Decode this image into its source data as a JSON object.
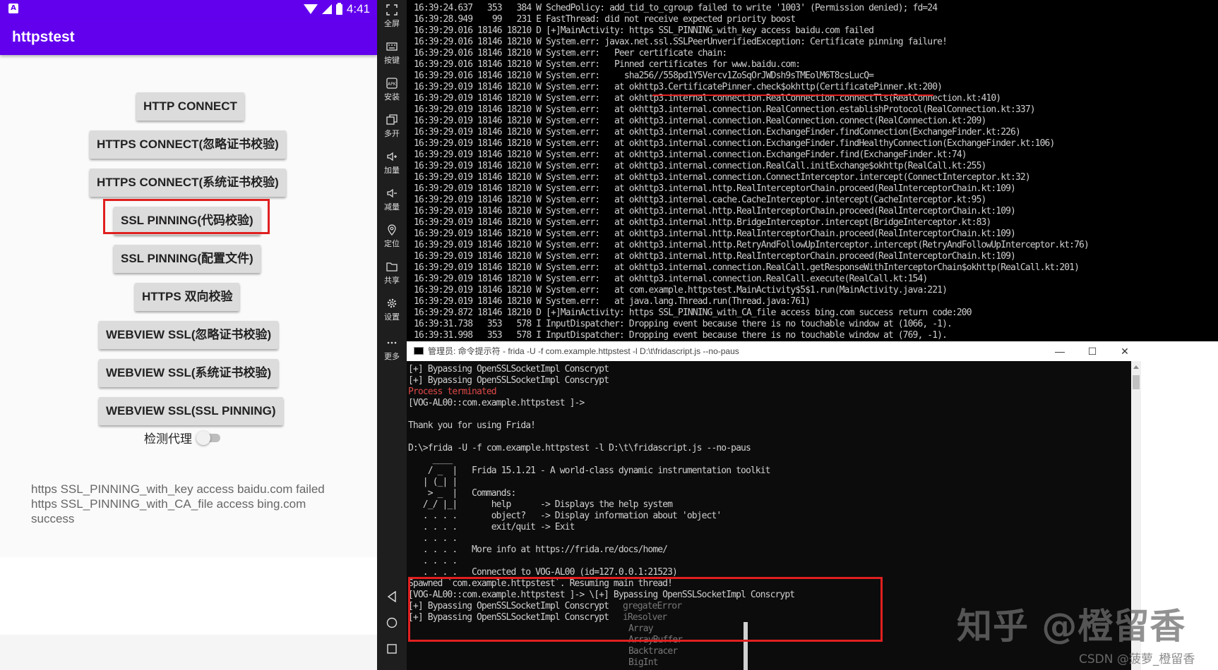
{
  "phone": {
    "status_bar": {
      "time": "4:41",
      "notification_icon": "A"
    },
    "app_title": "httpstest",
    "buttons": [
      {
        "label": "HTTP CONNECT"
      },
      {
        "label": "HTTPS CONNECT(忽略证书校验)"
      },
      {
        "label": "HTTPS CONNECT(系统证书校验)"
      },
      {
        "label": "SSL PINNING(代码校验)"
      },
      {
        "label": "SSL PINNING(配置文件)"
      },
      {
        "label": "HTTPS 双向校验"
      },
      {
        "label": "WEBVIEW SSL(忽略证书校验)"
      },
      {
        "label": "WEBVIEW SSL(系统证书校验)"
      },
      {
        "label": "WEBVIEW SSL(SSL PINNING)"
      }
    ],
    "proxy_toggle": {
      "label": "检测代理",
      "on": false
    },
    "result_lines": [
      "https SSL_PINNING_with_key access baidu.com failed",
      "https SSL_PINNING_with_CA_file access bing.com",
      "success"
    ]
  },
  "toolbar": {
    "items": [
      {
        "label": "全屏",
        "icon": "fullscreen-icon"
      },
      {
        "label": "按键",
        "icon": "keyboard-icon"
      },
      {
        "label": "安装",
        "icon": "apk-icon"
      },
      {
        "label": "多开",
        "icon": "multi-instance-icon"
      },
      {
        "label": "加量",
        "icon": "volume-up-icon"
      },
      {
        "label": "减量",
        "icon": "volume-down-icon"
      },
      {
        "label": "定位",
        "icon": "location-icon"
      },
      {
        "label": "共享",
        "icon": "folder-icon"
      },
      {
        "label": "设置",
        "icon": "gear-icon"
      },
      {
        "label": "更多",
        "icon": "more-icon"
      }
    ],
    "nav": [
      "back-icon",
      "home-icon",
      "recents-icon"
    ]
  },
  "logcat": {
    "lines": [
      "16:39:24.637   353   384 W SchedPolicy: add_tid_to_cgroup failed to write '1003' (Permission denied); fd=24",
      "16:39:28.949    99   231 E FastThread: did not receive expected priority boost",
      "16:39:29.016 18146 18210 D [+]MainActivity: https SSL_PINNING_with_key access baidu.com failed",
      "16:39:29.016 18146 18210 W System.err: javax.net.ssl.SSLPeerUnverifiedException: Certificate pinning failure!",
      "16:39:29.016 18146 18210 W System.err:   Peer certificate chain:",
      "16:39:29.016 18146 18210 W System.err:   Pinned certificates for www.baidu.com:",
      "16:39:29.016 18146 18210 W System.err:     sha256//558pd1Y5Vercv1ZoSqOrJWDsh9sTMEolM6T8csLucQ=",
      "16:39:29.019 18146 18210 W System.err:   at okhttp3.CertificatePinner.check$okhttp(CertificatePinner.kt:200)",
      "16:39:29.019 18146 18210 W System.err:   at okhttp3.internal.connection.RealConnection.connectTls(RealConnection.kt:410)",
      "16:39:29.019 18146 18210 W System.err:   at okhttp3.internal.connection.RealConnection.establishProtocol(RealConnection.kt:337)",
      "16:39:29.019 18146 18210 W System.err:   at okhttp3.internal.connection.RealConnection.connect(RealConnection.kt:209)",
      "16:39:29.019 18146 18210 W System.err:   at okhttp3.internal.connection.ExchangeFinder.findConnection(ExchangeFinder.kt:226)",
      "16:39:29.019 18146 18210 W System.err:   at okhttp3.internal.connection.ExchangeFinder.findHealthyConnection(ExchangeFinder.kt:106)",
      "16:39:29.019 18146 18210 W System.err:   at okhttp3.internal.connection.ExchangeFinder.find(ExchangeFinder.kt:74)",
      "16:39:29.019 18146 18210 W System.err:   at okhttp3.internal.connection.RealCall.initExchange$okhttp(RealCall.kt:255)",
      "16:39:29.019 18146 18210 W System.err:   at okhttp3.internal.connection.ConnectInterceptor.intercept(ConnectInterceptor.kt:32)",
      "16:39:29.019 18146 18210 W System.err:   at okhttp3.internal.http.RealInterceptorChain.proceed(RealInterceptorChain.kt:109)",
      "16:39:29.019 18146 18210 W System.err:   at okhttp3.internal.cache.CacheInterceptor.intercept(CacheInterceptor.kt:95)",
      "16:39:29.019 18146 18210 W System.err:   at okhttp3.internal.http.RealInterceptorChain.proceed(RealInterceptorChain.kt:109)",
      "16:39:29.019 18146 18210 W System.err:   at okhttp3.internal.http.BridgeInterceptor.intercept(BridgeInterceptor.kt:83)",
      "16:39:29.019 18146 18210 W System.err:   at okhttp3.internal.http.RealInterceptorChain.proceed(RealInterceptorChain.kt:109)",
      "16:39:29.019 18146 18210 W System.err:   at okhttp3.internal.http.RetryAndFollowUpInterceptor.intercept(RetryAndFollowUpInterceptor.kt:76)",
      "16:39:29.019 18146 18210 W System.err:   at okhttp3.internal.http.RealInterceptorChain.proceed(RealInterceptorChain.kt:109)",
      "16:39:29.019 18146 18210 W System.err:   at okhttp3.internal.connection.RealCall.getResponseWithInterceptorChain$okhttp(RealCall.kt:201)",
      "16:39:29.019 18146 18210 W System.err:   at okhttp3.internal.connection.RealCall.execute(RealCall.kt:154)",
      "16:39:29.019 18146 18210 W System.err:   at com.example.httpstest.MainActivity$5$1.run(MainActivity.java:221)",
      "16:39:29.019 18146 18210 W System.err:   at java.lang.Thread.run(Thread.java:761)",
      "16:39:29.872 18146 18210 D [+]MainActivity: https SSL_PINNING_with_CA_file access bing.com success return code:200",
      "16:39:31.738   353   578 I InputDispatcher: Dropping event because there is no touchable window at (1066, -1).",
      "16:39:31.998   353   578 I InputDispatcher: Dropping event because there is no touchable window at (769, -1)."
    ]
  },
  "cmd": {
    "title": "管理员: 命令提示符 - frida  -U -f com.example.httpstest -l D:\\t\\fridascript.js --no-paus",
    "window_controls": [
      "—",
      "☐",
      "✕"
    ],
    "lines": [
      {
        "text": "[+] Bypassing OpenSSLSocketImpl Conscrypt",
        "red": false
      },
      {
        "text": "[+] Bypassing OpenSSLSocketImpl Conscrypt",
        "red": false
      },
      {
        "text": "Process terminated",
        "red": true
      },
      {
        "text": "[VOG-AL00::com.example.httpstest ]->",
        "red": false
      },
      {
        "text": "",
        "red": false
      },
      {
        "text": "Thank you for using Frida!",
        "red": false
      },
      {
        "text": "",
        "red": false
      },
      {
        "text": "D:\\>frida -U -f com.example.httpstest -l D:\\t\\fridascript.js --no-paus",
        "red": false
      },
      {
        "text": "     ____",
        "red": false
      },
      {
        "text": "    / _  |   Frida 15.1.21 - A world-class dynamic instrumentation toolkit",
        "red": false
      },
      {
        "text": "   | (_| |",
        "red": false
      },
      {
        "text": "    > _  |   Commands:",
        "red": false
      },
      {
        "text": "   /_/ |_|       help      -> Displays the help system",
        "red": false
      },
      {
        "text": "   . . . .       object?   -> Display information about 'object'",
        "red": false
      },
      {
        "text": "   . . . .       exit/quit -> Exit",
        "red": false
      },
      {
        "text": "   . . . .",
        "red": false
      },
      {
        "text": "   . . . .   More info at https://frida.re/docs/home/",
        "red": false
      },
      {
        "text": "   . . . .",
        "red": false
      },
      {
        "text": "   . . . .   Connected to VOG-AL00 (id=127.0.0.1:21523)",
        "red": false
      },
      {
        "text": "Spawned `com.example.httpstest`. Resuming main thread!",
        "red": false
      },
      {
        "text": "[VOG-AL00::com.example.httpstest ]-> \\[+] Bypassing OpenSSLSocketImpl Conscrypt",
        "red": false
      },
      {
        "text": "[+] Bypassing OpenSSLSocketImpl Conscrypt",
        "red": false
      },
      {
        "text": "[+] Bypassing OpenSSLSocketImpl Conscrypt",
        "red": false
      }
    ],
    "suggestions": [
      "gregateError",
      "iResolver",
      "Array",
      "ArrayBuffer",
      "Backtracer",
      "BigInt"
    ]
  },
  "watermark": {
    "text": "知乎 @橙留香",
    "csdn": "CSDN @菠萝_橙留香"
  }
}
